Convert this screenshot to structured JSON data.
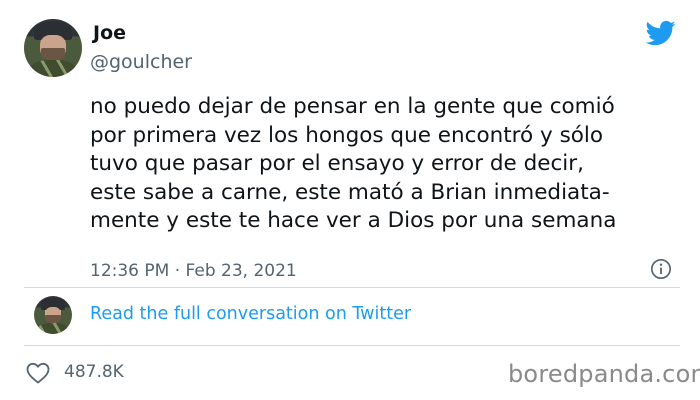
{
  "author": {
    "name": "Joe",
    "handle": "@goulcher"
  },
  "tweet": {
    "text": "no puedo dejar de pensar en la gente que comió\npor primera vez los hongos que encontró y sólo\ntuvo que pasar por el ensayo y error de decir,\neste sabe a carne, este mató a Brian inmediata-\nmente y este te hace ver a Dios por una semana",
    "timestamp": "12:36 PM · Feb 23, 2021"
  },
  "conversation_link": "Read the full conversation on Twitter",
  "likes": "487.8K",
  "watermark": "boredpanda.com",
  "icons": {
    "brand": "twitter-bird-icon",
    "info": "info-icon",
    "like": "heart-icon"
  },
  "colors": {
    "twitter_blue": "#1d9bf0",
    "secondary_text": "#536471",
    "primary_text": "#0f1419"
  }
}
